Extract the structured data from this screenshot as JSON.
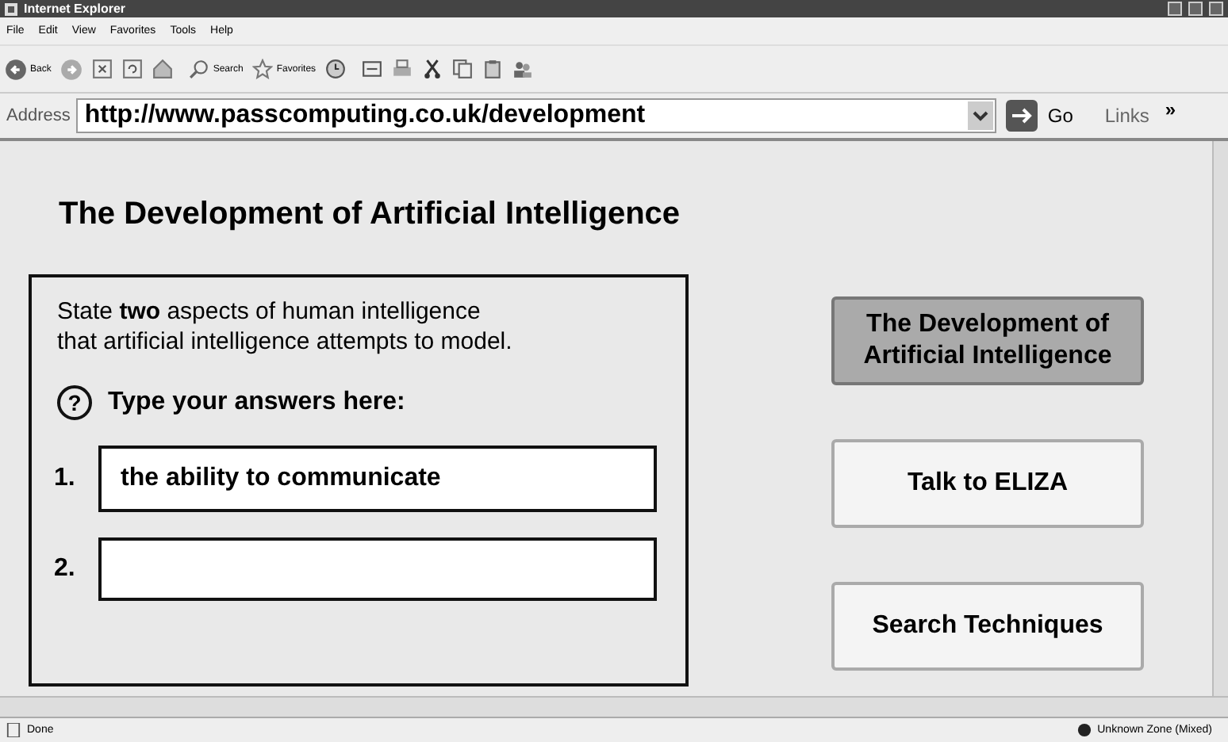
{
  "window": {
    "title": "Internet Explorer"
  },
  "menu": [
    "File",
    "Edit",
    "View",
    "Favorites",
    "Tools",
    "Help"
  ],
  "toolbar": {
    "back": "Back",
    "search": "Search",
    "favorites": "Favorites"
  },
  "address": {
    "label": "Address",
    "value": "http://www.passcomputing.co.uk/development",
    "go": "Go",
    "links": "Links",
    "more": "»"
  },
  "page": {
    "heading": "The Development of Artificial Intelligence",
    "question": "State **two** aspects of human intelligence\nthat artificial intelligence attempts to model.",
    "help_icon": "?",
    "prompt": "Type your answers here:",
    "answers": [
      {
        "number": "1.",
        "value": "the ability to communicate"
      },
      {
        "number": "2."
      }
    ],
    "nav": [
      {
        "label": "The Development of Artificial Intelligence",
        "selected": true
      },
      {
        "label": "Talk to ELIZA",
        "selected": false
      },
      {
        "label": "Search Techniques",
        "selected": false
      }
    ]
  },
  "status_bar": {
    "text": "Done",
    "zone": "Unknown Zone (Mixed)"
  }
}
